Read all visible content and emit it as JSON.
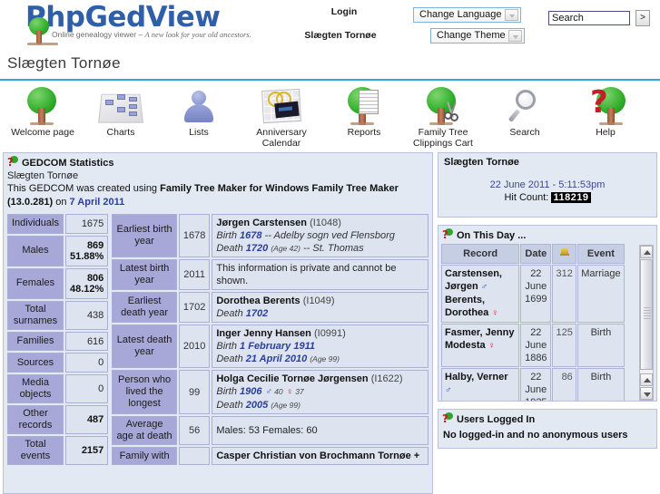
{
  "header": {
    "logo_main": "PhpGedView",
    "logo_tagline_plain": "Online genealogy viewer – ",
    "logo_tagline_italic": "A new look for your old ancestors.",
    "login_label": "Login",
    "gedcom_name": "Slægten Tornøe",
    "change_language": "Change Language",
    "change_theme": "Change Theme",
    "search_value": "Search",
    "search_go": ">",
    "accent_color": "#35a3dd",
    "logo_color": "#2f5fa8"
  },
  "page": {
    "title": "Slægten Tornøe"
  },
  "nav": {
    "items": [
      {
        "label": "Welcome page",
        "icon": "tree-icon",
        "name": "nav-welcome-page"
      },
      {
        "label": "Charts",
        "icon": "chart-icon",
        "name": "nav-charts"
      },
      {
        "label": "Lists",
        "icon": "person-icon",
        "name": "nav-lists"
      },
      {
        "label": "Anniversary Calendar",
        "label_l1": "Anniversary",
        "label_l2": "Calendar",
        "icon": "calendar-icon",
        "name": "nav-anniversary-calendar"
      },
      {
        "label": "Reports",
        "icon": "report-icon",
        "name": "nav-reports"
      },
      {
        "label": "Family Tree Clippings Cart",
        "label_l1": "Family Tree",
        "label_l2": "Clippings Cart",
        "icon": "scissors-tree-icon",
        "name": "nav-clippings-cart"
      },
      {
        "label": "Search",
        "icon": "magnifier-icon",
        "name": "nav-search"
      },
      {
        "label": "Help",
        "icon": "question-tree-icon",
        "name": "nav-help"
      }
    ]
  },
  "stats": {
    "panel_title": "GEDCOM Statistics",
    "gedcom_name": "Slægten Tornøe",
    "created_prefix": "This GEDCOM was created using ",
    "created_software": "Family Tree Maker for Windows Family Tree Maker (13.0.281)",
    "created_on_word": " on ",
    "created_date": "7 April 2011",
    "counts": [
      {
        "label": "Individuals",
        "value": "1675",
        "bold": false,
        "tall": false
      },
      {
        "label": "Males",
        "value": "869\n51.88%",
        "value_l1": "869",
        "value_l2": "51.88%",
        "bold": true,
        "tall": true
      },
      {
        "label": "Females",
        "value": "806\n48.12%",
        "value_l1": "806",
        "value_l2": "48.12%",
        "bold": true,
        "tall": true
      },
      {
        "label": "Total surnames",
        "value": "438",
        "bold": false,
        "tall": true
      },
      {
        "label": "Families",
        "value": "616",
        "bold": false,
        "tall": false
      },
      {
        "label": "Sources",
        "value": "0",
        "bold": false,
        "tall": false
      },
      {
        "label": "Media objects",
        "value": "0",
        "bold": false,
        "tall": true
      },
      {
        "label": "Other records",
        "value": "487",
        "bold": true,
        "tall": true
      },
      {
        "label": "Total events",
        "value": "2157",
        "bold": true,
        "tall": true
      }
    ],
    "records": [
      {
        "label": "Earliest birth year",
        "year": "1678",
        "name": "Jørgen Carstensen",
        "xref": "(I1048)",
        "private": false,
        "lines": [
          {
            "type": "birth",
            "word": "Birth ",
            "date": "1678",
            "rest": " -- Adelby sogn ved Flensborg",
            "age": ""
          },
          {
            "type": "death",
            "word": "Death ",
            "date": "1720",
            "rest": " -- St. Thomas",
            "age": "(Age 42)"
          }
        ]
      },
      {
        "label": "Latest birth year",
        "year": "2011",
        "private": true,
        "private_text": "This information is private and cannot be shown."
      },
      {
        "label": "Earliest death year",
        "year": "1702",
        "name": "Dorothea Berents",
        "xref": "(I1049)",
        "private": false,
        "lines": [
          {
            "type": "death",
            "word": "Death ",
            "date": "1702",
            "rest": "",
            "age": ""
          }
        ]
      },
      {
        "label": "Latest death year",
        "year": "2010",
        "name": "Inger Jenny Hansen",
        "xref": "(I0991)",
        "private": false,
        "lines": [
          {
            "type": "birth",
            "word": "Birth ",
            "date": "1 February 1911",
            "rest": "",
            "age": ""
          },
          {
            "type": "death",
            "word": "Death ",
            "date": "21 April 2010",
            "rest": "",
            "age": "(Age 99)"
          }
        ]
      },
      {
        "label": "Person who lived the longest",
        "year": "99",
        "name": "Holga Cecilie Tornøe Jørgensen",
        "xref": "(I1622)",
        "private": false,
        "lines": [
          {
            "type": "birth",
            "word": "Birth ",
            "date": "1906",
            "rest": "",
            "age": "",
            "male_count": "40",
            "female_count": "37"
          },
          {
            "type": "death",
            "word": "Death ",
            "date": "2005",
            "rest": "",
            "age": "(Age 99)"
          }
        ]
      },
      {
        "label": "Average age at death",
        "year": "56",
        "plain": "Males: 53   Females: 60",
        "private": false
      },
      {
        "label": "Family with",
        "year": "",
        "name": "Casper Christian von Brochmann Tornøe +",
        "xref": "",
        "private": false,
        "lines": []
      }
    ]
  },
  "side": {
    "gedinfo": {
      "name": "Slægten Tornøe",
      "datetime": "22 June 2011 - 5:11:53pm",
      "hit_label": "Hit Count:",
      "hit_count": "118219"
    },
    "onthisday": {
      "title": "On This Day ...",
      "columns": [
        "Record",
        "Date",
        "anniversary-bell-icon",
        "Event"
      ],
      "col_anniversary_icon": "bell-icon",
      "rows": [
        {
          "record": "Carstensen, Jørgen ♂ Berents, Dorothea ♀",
          "record_l1": "Carstensen,",
          "record_l2": "Jørgen",
          "record_l3": "Berents,",
          "record_l4": "Dorothea",
          "sex1": "male",
          "sex2": "female",
          "date": "22 June 1699",
          "anniversary": "312",
          "event": "Marriage"
        },
        {
          "record": "Fasmer, Jenny Modesta ♀",
          "record_l1": "Fasmer, Jenny",
          "record_l2": "Modesta",
          "sex1": "female",
          "date": "22 June 1886",
          "anniversary": "125",
          "event": "Birth"
        },
        {
          "record": "Halby, Verner ♂",
          "record_l1": "Halby, Verner",
          "sex1": "male",
          "date": "22 June 1925",
          "anniversary": "86",
          "event": "Birth"
        }
      ]
    },
    "loggedin": {
      "title": "Users Logged In",
      "message": "No logged-in and no anonymous users"
    }
  }
}
